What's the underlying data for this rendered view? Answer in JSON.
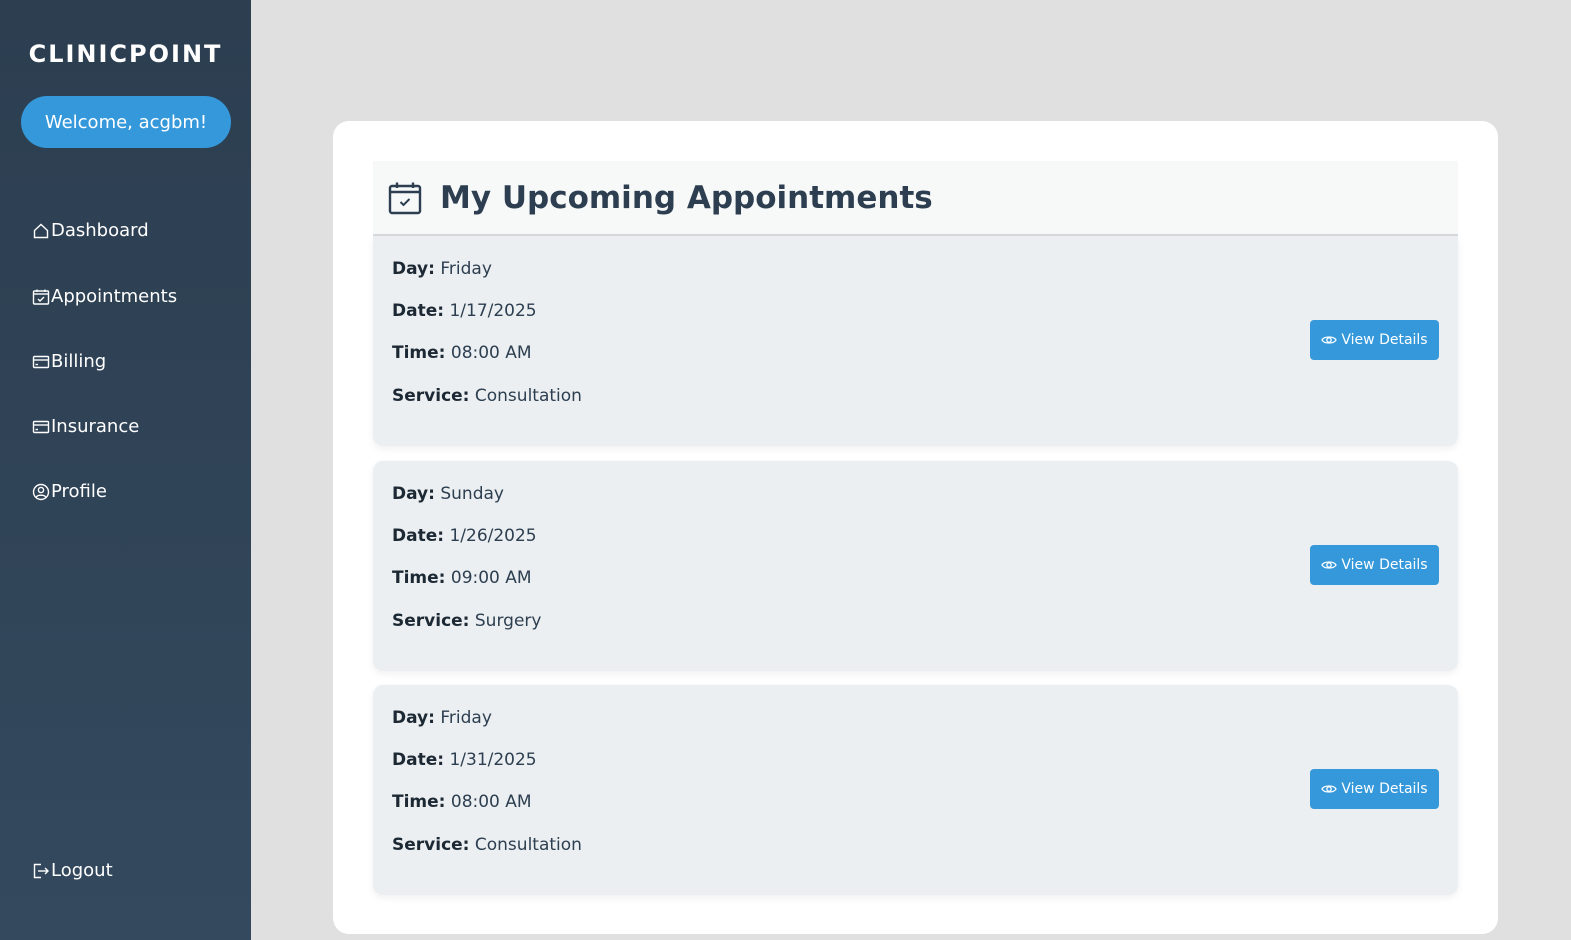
{
  "sidebar": {
    "logo": "CLINICPOINT",
    "welcome": "Welcome, acgbm!",
    "nav": {
      "dashboard": "Dashboard",
      "appointments": "Appointments",
      "billing": "Billing",
      "insurance": "Insurance",
      "profile": "Profile",
      "logout": "Logout"
    }
  },
  "main": {
    "title": "My Upcoming Appointments",
    "labels": {
      "day": "Day:",
      "date": "Date:",
      "time": "Time:",
      "service": "Service:"
    },
    "button_label": "View Details",
    "appointments": [
      {
        "day": "Friday",
        "date": "1/17/2025",
        "time": "08:00 AM",
        "service": "Consultation"
      },
      {
        "day": "Sunday",
        "date": "1/26/2025",
        "time": "09:00 AM",
        "service": "Surgery"
      },
      {
        "day": "Friday",
        "date": "1/31/2025",
        "time": "08:00 AM",
        "service": "Consultation"
      }
    ]
  },
  "colors": {
    "sidebar_top": "#2c3e50",
    "sidebar_bottom": "#34495e",
    "accent": "#3498db",
    "page_bg": "#e0e0e0",
    "appointment_bg": "#ebeff1"
  },
  "icons": {
    "dashboard": "home-icon",
    "appointments": "calendar-check-icon",
    "billing": "credit-card-icon",
    "insurance": "credit-card-icon",
    "profile": "user-circle-icon",
    "logout": "logout-icon",
    "header": "calendar-check-icon",
    "view": "eye-icon"
  }
}
